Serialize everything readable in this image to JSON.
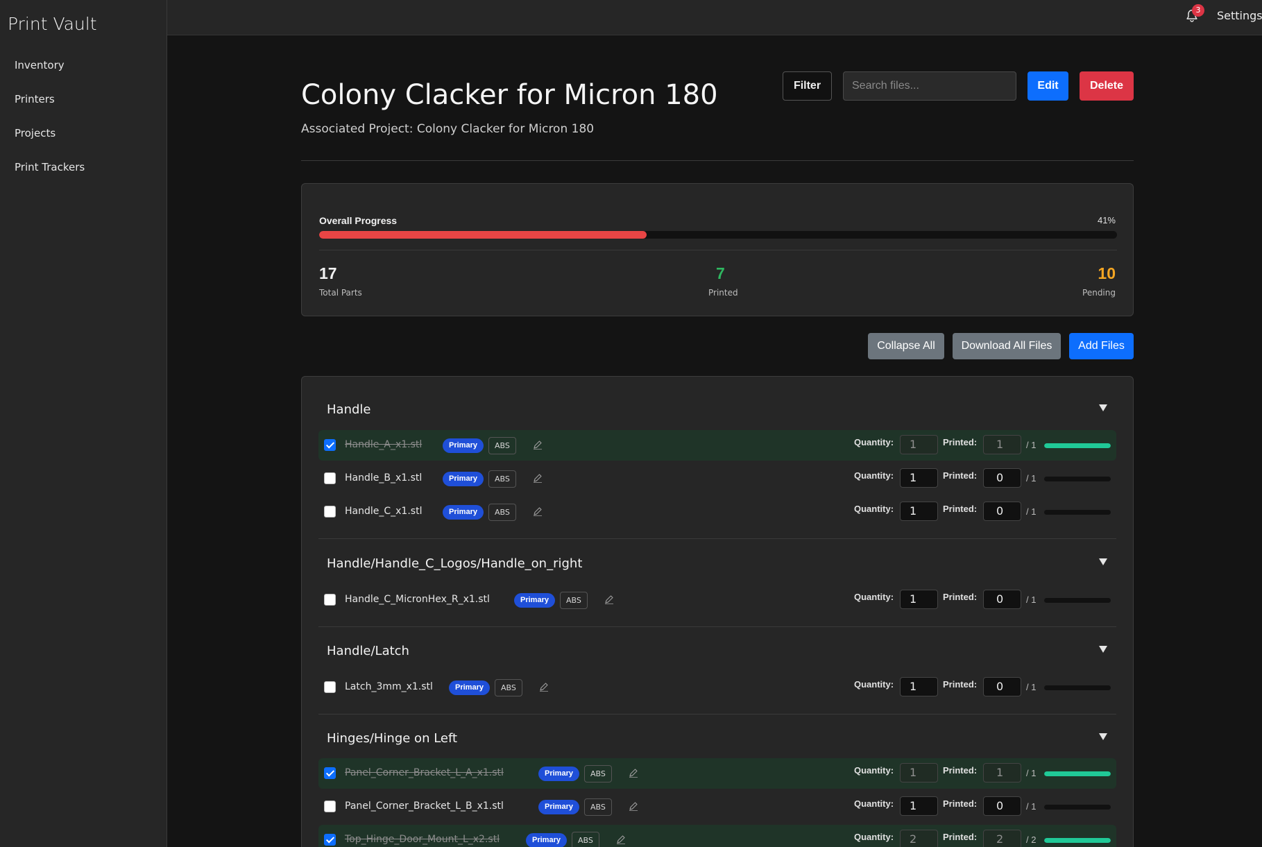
{
  "app": {
    "brand": "Print Vault"
  },
  "sidebar": {
    "items": [
      {
        "label": "Inventory"
      },
      {
        "label": "Printers"
      },
      {
        "label": "Projects"
      },
      {
        "label": "Print Trackers"
      }
    ]
  },
  "topbar": {
    "notification_count": "3",
    "settings_label": "Settings"
  },
  "header": {
    "title": "Colony Clacker for Micron 180",
    "subtitle": "Associated Project: Colony Clacker for Micron 180",
    "filter_label": "Filter",
    "search_placeholder": "Search files...",
    "edit_label": "Edit",
    "delete_label": "Delete"
  },
  "progress": {
    "label": "Overall Progress",
    "percent_text": "41%",
    "percent": 41,
    "bar_color": "#e84545",
    "stats": {
      "total": {
        "value": "17",
        "label": "Total Parts",
        "color": "#f2f2f2"
      },
      "printed": {
        "value": "7",
        "label": "Printed",
        "color": "#2fb760"
      },
      "pending": {
        "value": "10",
        "label": "Pending",
        "color": "#f5a623"
      }
    }
  },
  "actions": {
    "collapse_label": "Collapse All",
    "download_label": "Download All Files",
    "add_label": "Add Files"
  },
  "labels": {
    "quantity": "Quantity:",
    "printed": "Printed:",
    "primary_badge": "Primary",
    "done_color": "#20c997"
  },
  "groups": [
    {
      "title": "Handle",
      "files": [
        {
          "name": "Handle_A_x1.stl",
          "material": "ABS",
          "quantity": "1",
          "printed": "1",
          "of": "/ 1",
          "progress": 1,
          "done": true
        },
        {
          "name": "Handle_B_x1.stl",
          "material": "ABS",
          "quantity": "1",
          "printed": "0",
          "of": "/ 1",
          "progress": 0,
          "done": false
        },
        {
          "name": "Handle_C_x1.stl",
          "material": "ABS",
          "quantity": "1",
          "printed": "0",
          "of": "/ 1",
          "progress": 0,
          "done": false
        }
      ]
    },
    {
      "title": "Handle/Handle_C_Logos/Handle_on_right",
      "files": [
        {
          "name": "Handle_C_MicronHex_R_x1.stl",
          "material": "ABS",
          "quantity": "1",
          "printed": "0",
          "of": "/ 1",
          "progress": 0,
          "done": false
        }
      ]
    },
    {
      "title": "Handle/Latch",
      "files": [
        {
          "name": "Latch_3mm_x1.stl",
          "material": "ABS",
          "quantity": "1",
          "printed": "0",
          "of": "/ 1",
          "progress": 0,
          "done": false
        }
      ]
    },
    {
      "title": "Hinges/Hinge on Left",
      "files": [
        {
          "name": "Panel_Corner_Bracket_L_A_x1.stl",
          "material": "ABS",
          "quantity": "1",
          "printed": "1",
          "of": "/ 1",
          "progress": 1,
          "done": true
        },
        {
          "name": "Panel_Corner_Bracket_L_B_x1.stl",
          "material": "ABS",
          "quantity": "1",
          "printed": "0",
          "of": "/ 1",
          "progress": 0,
          "done": false
        },
        {
          "name": "Top_Hinge_Door_Mount_L_x2.stl",
          "material": "ABS",
          "quantity": "2",
          "printed": "2",
          "of": "/ 2",
          "progress": 1,
          "done": true
        }
      ]
    }
  ]
}
